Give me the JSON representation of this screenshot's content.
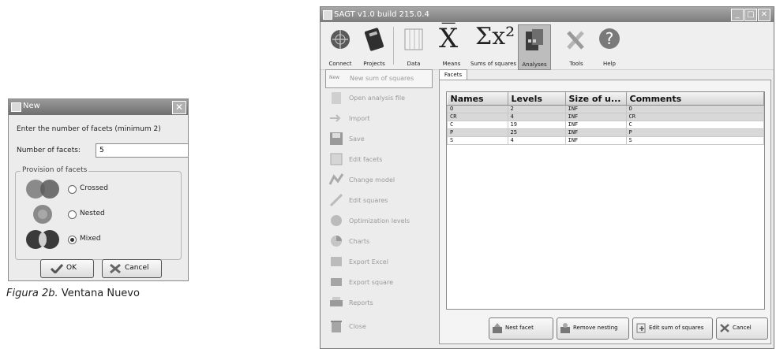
{
  "dialog": {
    "title": "New",
    "prompt": "Enter the number of facets (minimum 2)",
    "facets_label": "Number of facets:",
    "facets_value": "5",
    "provision_label": "Provision of facets",
    "options": [
      {
        "label": "Crossed",
        "selected": false
      },
      {
        "label": "Nested",
        "selected": false
      },
      {
        "label": "Mixed",
        "selected": true
      }
    ],
    "ok": "OK",
    "cancel": "Cancel"
  },
  "caption": {
    "italic": "Figura 2b.",
    "rest": " Ventana Nuevo"
  },
  "app": {
    "title": "SAGT v1.0 build 215.0.4",
    "toolbar": [
      "Connect",
      "Projects",
      "Data",
      "Means",
      "Sums of squares",
      "Analyses",
      "Tools",
      "Help"
    ],
    "active_tool": "Analyses",
    "side_menu": [
      "New sum of squares",
      "Open analysis file",
      "Import",
      "Save",
      "Edit facets",
      "Change model",
      "Edit squares",
      "Optimization levels",
      "Charts",
      "Export Excel",
      "Export square",
      "Reports",
      "Close"
    ],
    "tab": "Facets",
    "columns": [
      "Names",
      "Levels",
      "Size of u...",
      "Comments"
    ],
    "rows": [
      [
        "O",
        "2",
        "INF",
        "O"
      ],
      [
        "CR",
        "4",
        "INF",
        "CR"
      ],
      [
        "C",
        "19",
        "INF",
        "C"
      ],
      [
        "P",
        "25",
        "INF",
        "P"
      ],
      [
        "S",
        "4",
        "INF",
        "S"
      ]
    ],
    "buttons": [
      "Nest facet",
      "Remove nesting",
      "Edit sum of squares",
      "Cancel"
    ],
    "colors": {
      "title_bar": "#8a8a8a",
      "selected_row": "#d8d8d8",
      "active_tool_bg": "#bdbdbd"
    }
  }
}
